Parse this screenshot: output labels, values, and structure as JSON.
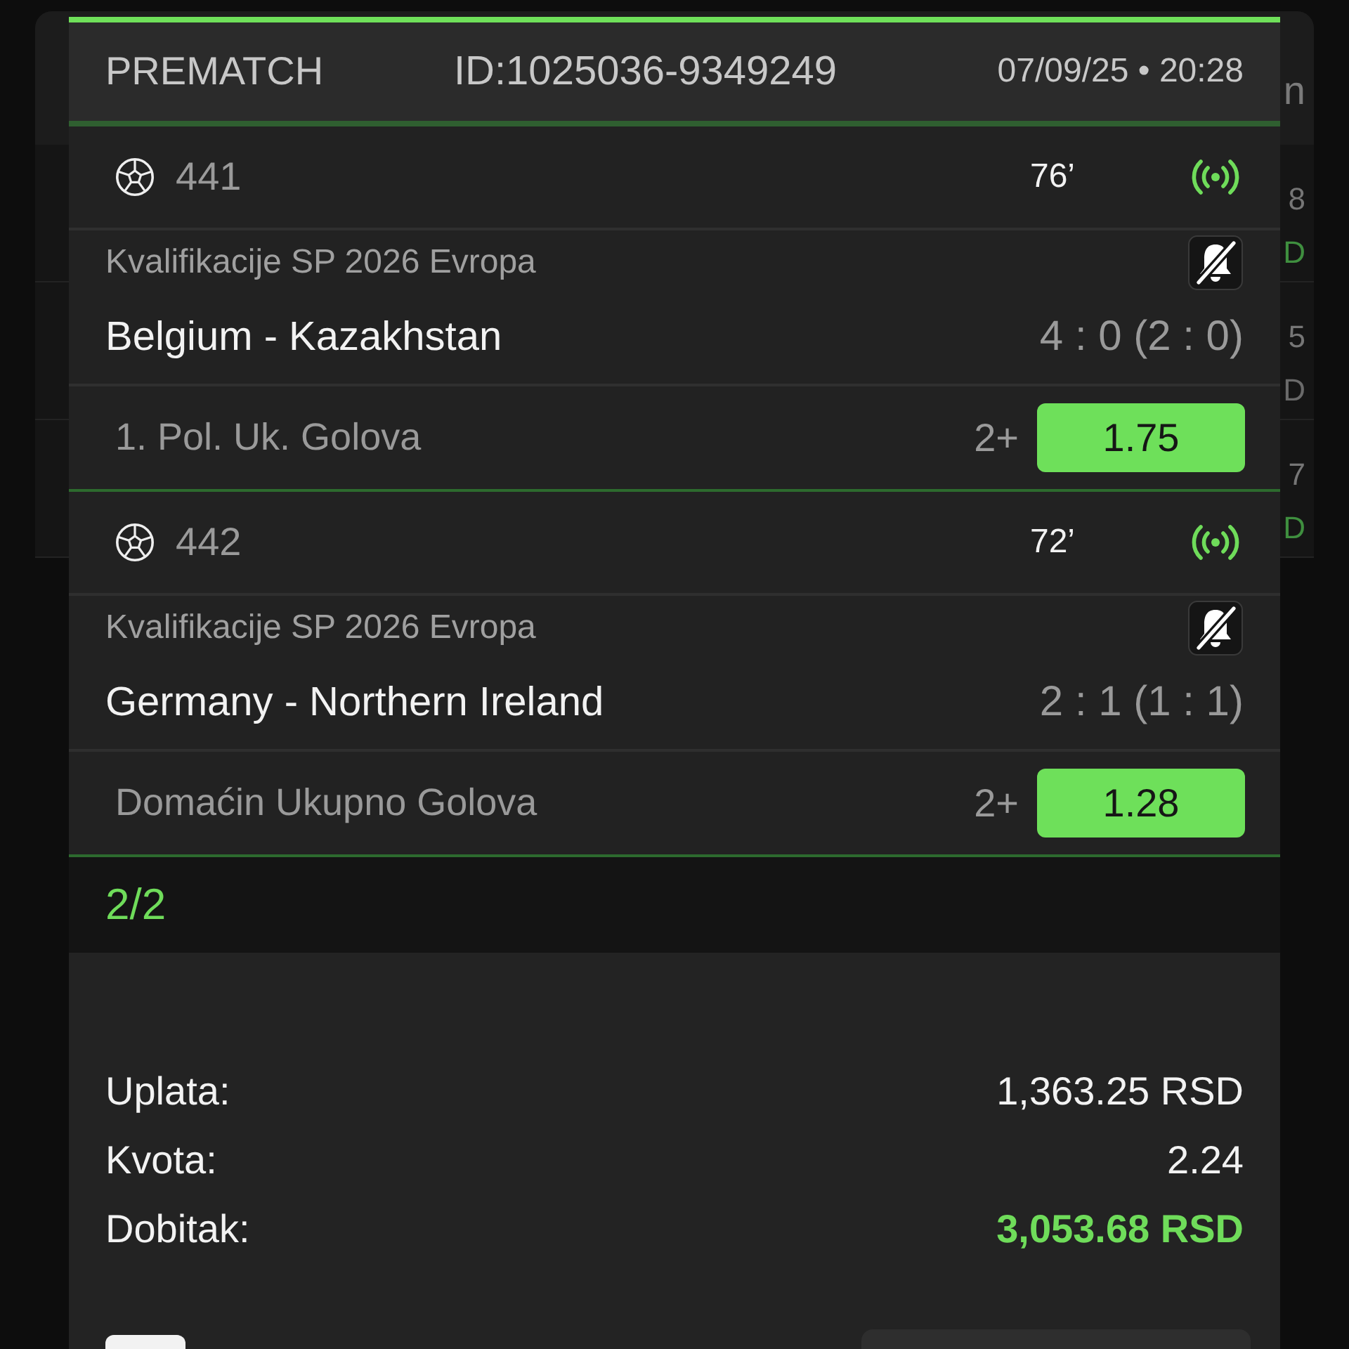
{
  "background_list": {
    "header": "n",
    "rows": [
      {
        "value": "8",
        "unit": "D",
        "color": "#3f8f3f"
      },
      {
        "value": "5",
        "unit": "D",
        "color": "#6a6a6a"
      },
      {
        "value": "7",
        "unit": "D",
        "color": "#3f8f3f"
      }
    ]
  },
  "ticket": {
    "type": "PREMATCH",
    "id": "ID:1025036-9349249",
    "datetime": "07/09/25 • 20:28"
  },
  "matches": [
    {
      "code": "441",
      "minute": "76’",
      "live": true,
      "league": "Kvalifikacije SP 2026 Evropa",
      "notifications_muted": true,
      "teams": "Belgium - Kazakhstan",
      "score": "4 : 0 (2 : 0)",
      "market": "1. Pol. Uk. Golova",
      "pick": "2+",
      "odds": "1.75",
      "won": true
    },
    {
      "code": "442",
      "minute": "72’",
      "live": true,
      "league": "Kvalifikacije SP 2026 Evropa",
      "notifications_muted": true,
      "teams": "Germany - Northern Ireland",
      "score": "2 : 1 (1 : 1)",
      "market": "Domaćin Ukupno Golova",
      "pick": "2+",
      "odds": "1.28",
      "won": true
    }
  ],
  "progress": "2/2",
  "totals": [
    {
      "label": "Uplata:",
      "value": "1,363.25 RSD",
      "highlight": false
    },
    {
      "label": "Kvota:",
      "value": "2.24",
      "highlight": false
    },
    {
      "label": "Dobitak:",
      "value": "3,053.68 RSD",
      "highlight": true
    }
  ],
  "checkbox": {
    "checked": false
  }
}
